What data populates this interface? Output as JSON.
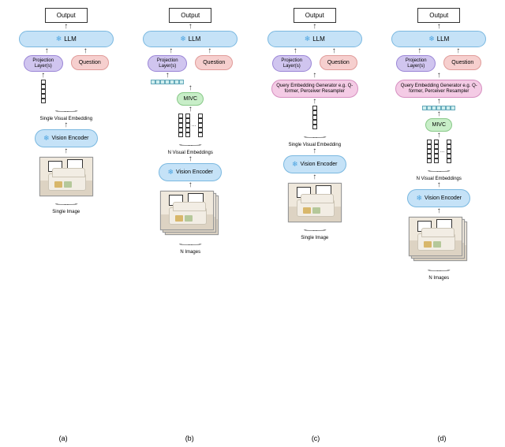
{
  "output_label": "Output",
  "llm_label": "LLM",
  "proj_label": "Projection Layer(s)",
  "question_label": "Question",
  "mivc_label": "MIVC",
  "qeg_label": "Query Embedding Generator e.g. Q-former, Perceiver Resampler",
  "vision_encoder_label": "Vision Encoder",
  "single_visual_emb": "Single Visual Embedding",
  "n_visual_emb": "N Visual Embeddings",
  "single_image": "Single Image",
  "n_images": "N Images",
  "labels": {
    "a": "(a)",
    "b": "(b)",
    "c": "(c)",
    "d": "(d)"
  },
  "snowflake": "❄",
  "chart_data": {
    "type": "diagram",
    "description": "Four architecture variants of a multimodal LLM pipeline with a frozen LLM and vision encoder.",
    "variants": [
      {
        "id": "a",
        "input": "Single Image",
        "flow": [
          "Vision Encoder (frozen)",
          "Single Visual Embedding",
          "Projection Layer(s)",
          "LLM (frozen, + Question)",
          "Output"
        ]
      },
      {
        "id": "b",
        "input": "N Images",
        "flow": [
          "Vision Encoder (frozen)",
          "N Visual Embeddings",
          "MIVC",
          "Projection Layer(s)",
          "LLM (frozen, + Question)",
          "Output"
        ]
      },
      {
        "id": "c",
        "input": "Single Image",
        "flow": [
          "Vision Encoder (frozen)",
          "Single Visual Embedding",
          "Query Embedding Generator (Q-former / Perceiver Resampler)",
          "Projection Layer(s)",
          "LLM (frozen, + Question)",
          "Output"
        ]
      },
      {
        "id": "d",
        "input": "N Images",
        "flow": [
          "Vision Encoder (frozen)",
          "N Visual Embeddings",
          "MIVC",
          "Query Embedding Generator (Q-former / Perceiver Resampler)",
          "Projection Layer(s)",
          "LLM (frozen, + Question)",
          "Output"
        ]
      }
    ]
  }
}
